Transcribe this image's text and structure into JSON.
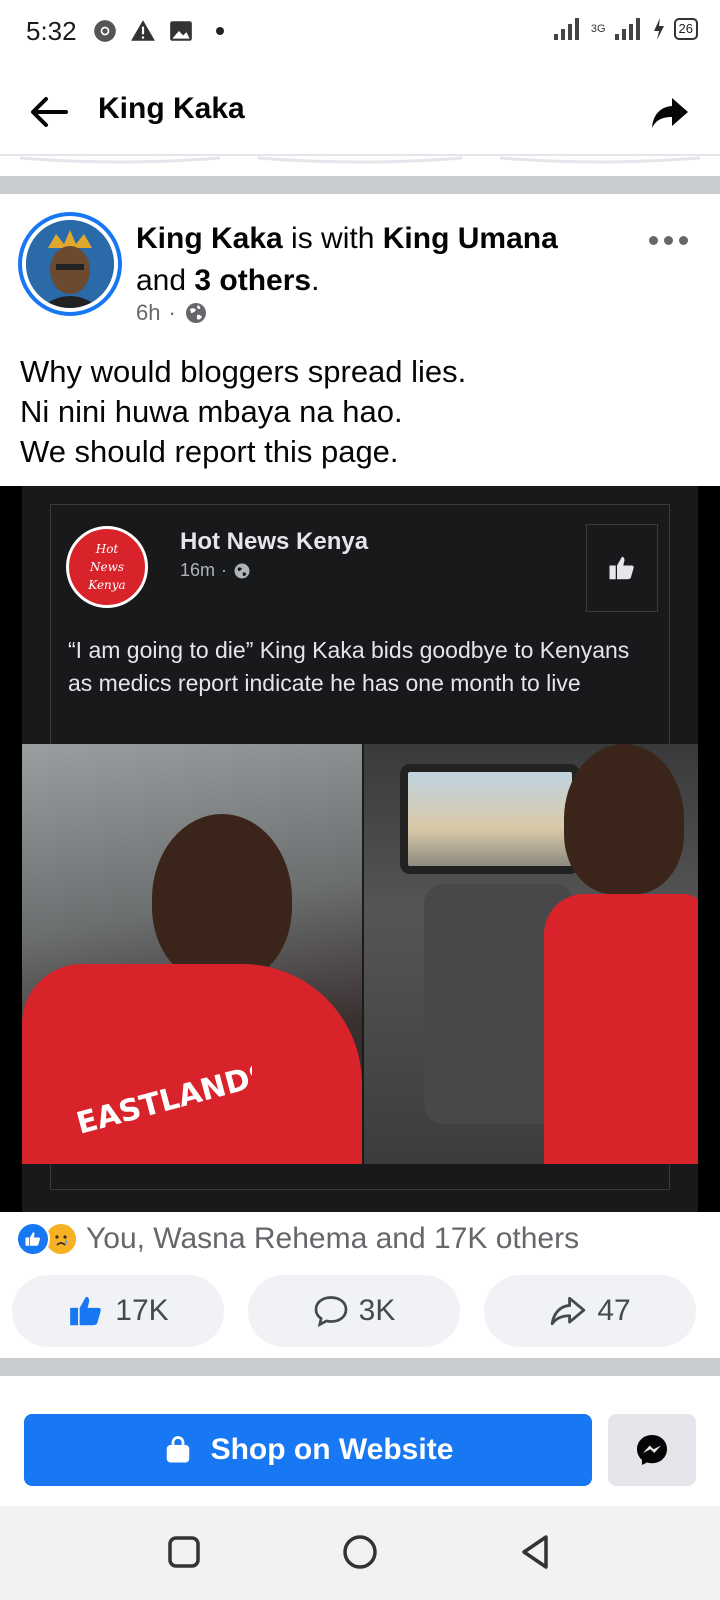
{
  "status_bar": {
    "time": "5:32",
    "battery": "26",
    "network": "3G"
  },
  "app_bar": {
    "title": "King Kaka"
  },
  "post": {
    "author": "King Kaka",
    "with_text": " is with ",
    "tagged": "King Umana",
    "and_text": "and ",
    "others": "3 others",
    "period": ".",
    "time": "6h",
    "separator": "·",
    "text_lines": [
      "Why would bloggers spread lies.",
      "Ni nini huwa mbaya na hao.",
      "We should report this page."
    ]
  },
  "shared_post": {
    "logo_lines": [
      "Hot",
      "News",
      "Kenya"
    ],
    "page_name": "Hot News Kenya",
    "time": "16m",
    "separator": "·",
    "headline": "“I am going to die” King Kaka bids goodbye to Kenyans as medics report indicate he has one month to live",
    "hoodie_text": "EASTLANDS"
  },
  "reactions": {
    "summary": "You, Wasna Rehema and 17K others",
    "like_count": "17K",
    "comment_count": "3K",
    "share_count": "47"
  },
  "cta": {
    "shop_label": "Shop on Website"
  },
  "colors": {
    "brand_blue": "#1877f2",
    "dark_card": "#18191a",
    "logo_red": "#d8232a"
  },
  "icons": {
    "back": "arrow-left-icon",
    "share": "share-arrow-icon",
    "more": "more-horizontal-icon",
    "globe": "globe-icon",
    "like": "thumbs-up-icon",
    "comment": "comment-bubble-icon",
    "share_action": "share-outline-icon",
    "shop": "shopping-bag-icon",
    "messenger": "messenger-icon"
  }
}
